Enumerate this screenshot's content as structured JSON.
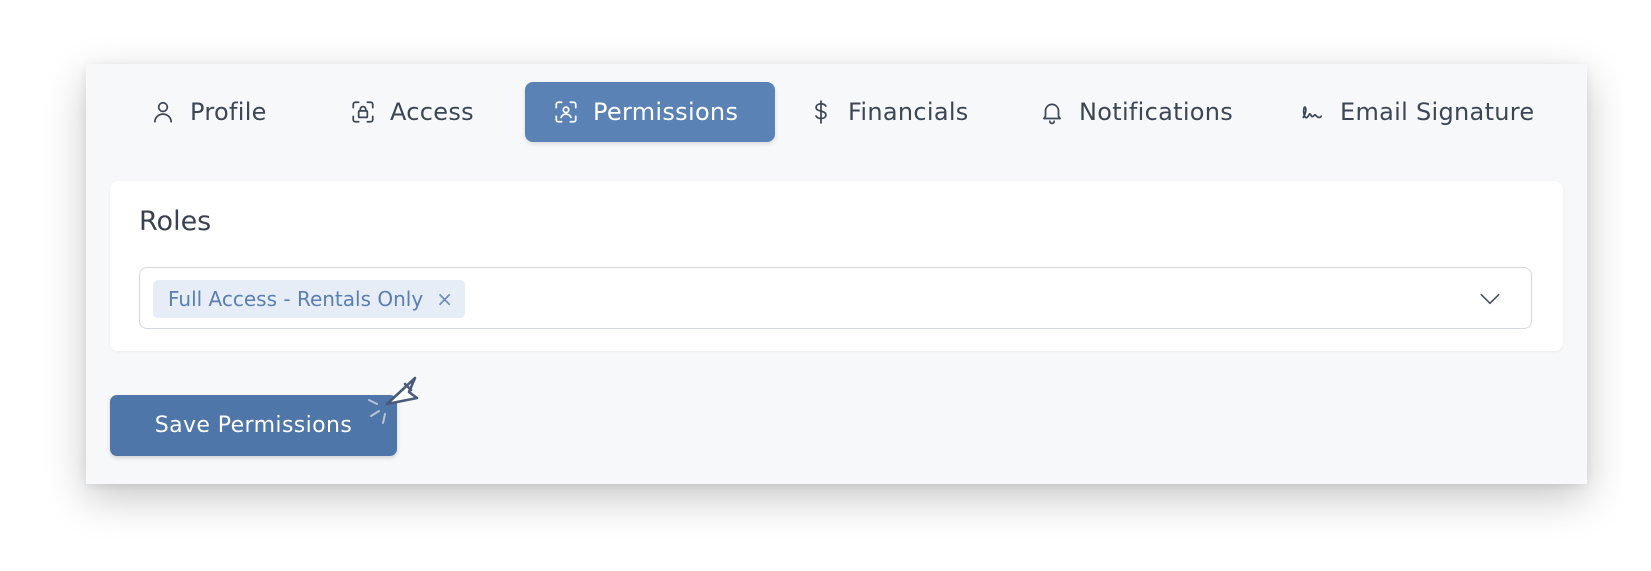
{
  "tabs": [
    {
      "label": "Profile",
      "icon": "user-icon",
      "active": false
    },
    {
      "label": "Access",
      "icon": "lock-scan-icon",
      "active": false
    },
    {
      "label": "Permissions",
      "icon": "user-scan-icon",
      "active": true
    },
    {
      "label": "Financials",
      "icon": "dollar-icon",
      "active": false
    },
    {
      "label": "Notifications",
      "icon": "bell-icon",
      "active": false
    },
    {
      "label": "Email Signature",
      "icon": "signature-icon",
      "active": false
    }
  ],
  "roles": {
    "title": "Roles",
    "selected": [
      "Full Access - Rentals Only"
    ],
    "remove_glyph": "×"
  },
  "save_button": {
    "label": "Save Permissions"
  },
  "colors": {
    "accent": "#5b82b5",
    "button": "#4e76a8",
    "chip_bg": "#e6edf6",
    "chip_text": "#5b7fae",
    "text": "#3d4654"
  }
}
